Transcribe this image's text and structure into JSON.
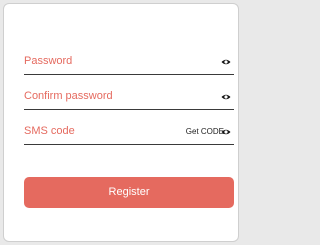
{
  "form": {
    "password": {
      "placeholder": "Password",
      "icon": "eye-icon"
    },
    "confirm_password": {
      "placeholder": "Confirm password",
      "icon": "eye-icon"
    },
    "sms_code": {
      "placeholder": "SMS code",
      "action_label": "Get CODE",
      "icon": "eye-icon"
    },
    "register_label": "Register"
  },
  "colors": {
    "accent": "#e56a5f",
    "underline": "#3a3a3a",
    "background": "#ffffff"
  }
}
